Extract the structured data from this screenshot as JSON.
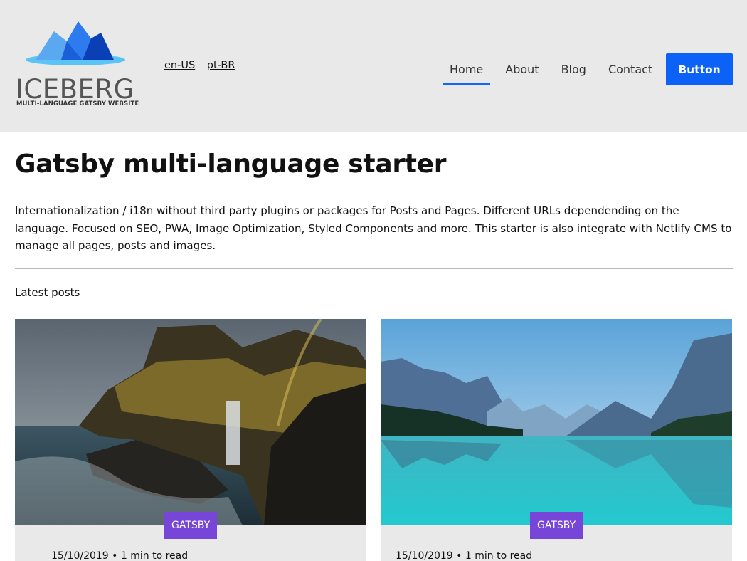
{
  "brand": {
    "name": "ICEBERG",
    "tagline": "MULTI-LANGUAGE GATSBY WEBSITE",
    "colors": {
      "dark": "#0a3fb5",
      "mid": "#2e7bf0",
      "light": "#8ad4f8",
      "water": "#59c4f5"
    }
  },
  "languages": [
    "en-US",
    "pt-BR"
  ],
  "nav": {
    "items": [
      {
        "label": "Home",
        "active": true
      },
      {
        "label": "About",
        "active": false
      },
      {
        "label": "Blog",
        "active": false
      },
      {
        "label": "Contact",
        "active": false
      }
    ],
    "button_label": "Button",
    "accent": "#0c62f7"
  },
  "main": {
    "title": "Gatsby multi-language starter",
    "intro": "Internationalization / i18n without third party plugins or packages for Posts and Pages. Different URLs dependending on the language. Focused on SEO, PWA, Image Optimization, Styled Components and more. This starter is also integrate with Netlify CMS to manage all pages, posts and images.",
    "latest_label": "Latest posts"
  },
  "posts": [
    {
      "tag": "GATSBY",
      "date": "15/10/2019",
      "read_time": "1 min to read",
      "image": "coastal-cliff-waterfall-rainbow"
    },
    {
      "tag": "GATSBY",
      "date": "15/10/2019",
      "read_time": "1 min to read",
      "image": "mountain-lake-reflection"
    }
  ],
  "tag_color": "#7745d8"
}
